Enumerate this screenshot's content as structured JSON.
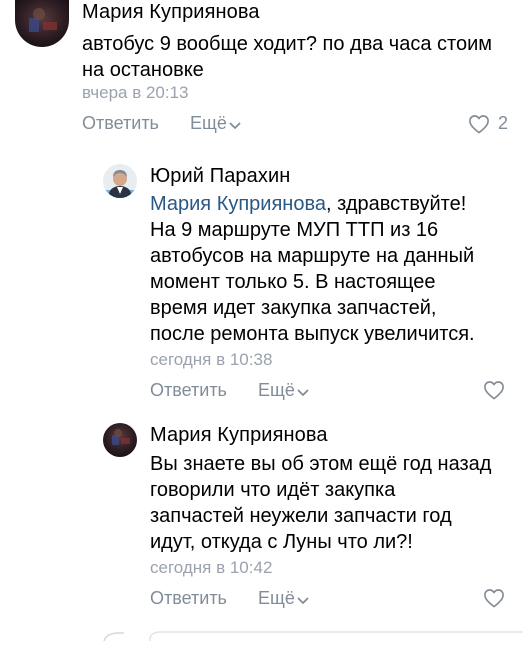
{
  "comments": [
    {
      "author": "Мария Куприянова",
      "lines": [
        "автобус 9 вообще ходит? по два часа стоим",
        "на остановке"
      ],
      "time": "вчера в 20:13",
      "reply": "Ответить",
      "more": "Ещё",
      "likes": "2",
      "icons": {
        "more": "chevron-down-icon",
        "like": "heart-icon"
      }
    },
    {
      "author": "Юрий Парахин",
      "mention": "Мария Куприянова",
      "mention_rest": ", здравствуйте!",
      "lines": [
        "На 9 маршруте МУП ТТП из 16",
        "автобусов на маршруте на данный",
        "момент только 5. В настоящее",
        "время идет закупка запчастей,",
        "после ремонта выпуск увеличится."
      ],
      "time": "сегодня в 10:38",
      "reply": "Ответить",
      "more": "Ещё",
      "icons": {
        "more": "chevron-down-icon",
        "like": "heart-icon"
      }
    },
    {
      "author": "Мария Куприянова",
      "lines": [
        "Вы знаете вы об этом ещё год назад",
        "говорили что идёт закупка",
        "запчастей неужели запчасти год",
        "идут, откуда с Луны что ли?!"
      ],
      "time": "сегодня в 10:42",
      "reply": "Ответить",
      "more": "Ещё",
      "icons": {
        "more": "chevron-down-icon",
        "like": "heart-icon"
      }
    }
  ],
  "colors": {
    "link": "#2a5885",
    "secondary": "#818c99",
    "timestamp": "#99a2ad"
  }
}
